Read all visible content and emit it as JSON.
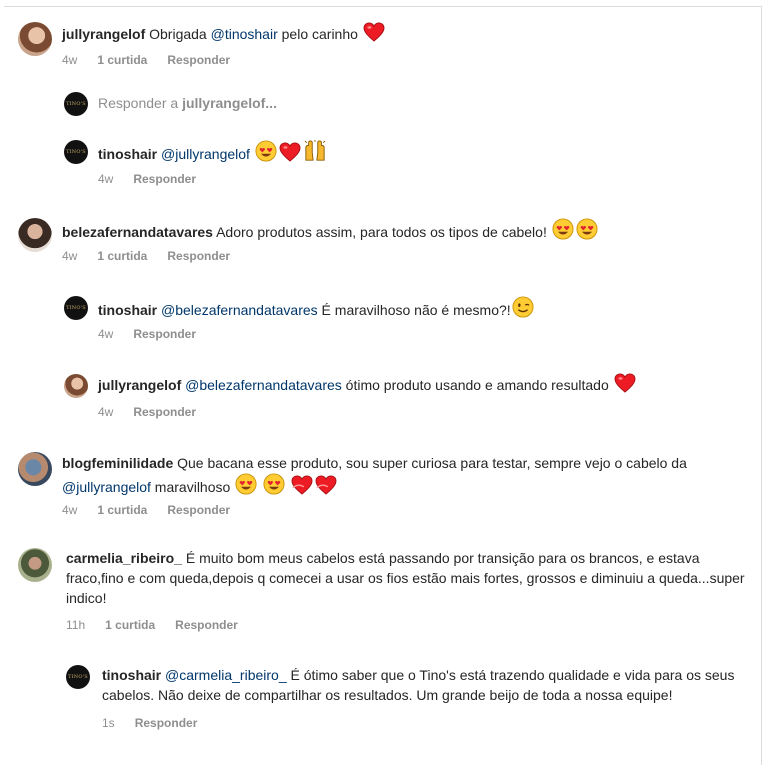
{
  "comments": [
    {
      "user": "jullyrangelof",
      "pre": "Obrigada ",
      "mention": "@tinoshair",
      "post": " pelo carinho",
      "emojis": [
        "heart"
      ],
      "time": "4w",
      "likes": "1 curtida",
      "reply": "Responder"
    },
    {
      "user": "tinoshair",
      "mention": "@jullyrangelof",
      "emojis": [
        "heart-eyes",
        "heart",
        "raised-hands"
      ],
      "time": "4w",
      "reply": "Responder"
    },
    {
      "user": "belezafernandatavares",
      "text": "Adoro produtos assim, para todos os tipos de cabelo!",
      "emojis": [
        "heart-eyes",
        "heart-eyes"
      ],
      "time": "4w",
      "likes": "1 curtida",
      "reply": "Responder"
    },
    {
      "user": "tinoshair",
      "mention": "@belezafernandatavares",
      "post": " É maravilhoso não é mesmo?!",
      "emojis": [
        "wink"
      ],
      "time": "4w",
      "reply": "Responder"
    },
    {
      "user": "jullyrangelof",
      "mention": "@belezafernandatavares",
      "post": " ótimo produto usando e amando resultado",
      "emojis": [
        "heart"
      ],
      "time": "4w",
      "reply": "Responder"
    },
    {
      "user": "blogfeminilidade",
      "pre": " Que bacana esse produto, sou super curiosa para testar, sempre vejo o cabelo da",
      "mention": "@jullyrangelof",
      "post": " maravilhoso",
      "emojis": [
        "heart-eyes",
        "heart-eyes",
        "heart-exclamation",
        "heart-exclamation"
      ],
      "time": "4w",
      "likes": "1 curtida",
      "reply": "Responder"
    },
    {
      "user": "carmelia_ribeiro_",
      "text": " É muito bom meus cabelos está passando por transição para os brancos, e estava fraco,fino e com queda,depois q comecei a usar os fios estão mais fortes, grossos e diminuiu a queda...super indico!",
      "time": "11h",
      "likes": "1 curtida",
      "reply": "Responder"
    },
    {
      "user": "tinoshair",
      "mention": "@carmelia_ribeiro_",
      "post": " É ótimo saber que o Tino's está trazendo qualidade e vida para os seus cabelos. Não deixe de compartilhar os resultados. Um grande beijo de toda a nossa equipe!",
      "time": "1s",
      "reply": "Responder"
    }
  ],
  "reply_input": {
    "prefix": "Responder a ",
    "target": "jullyrangelof...",
    "avatar_user": "tinoshair"
  },
  "colors": {
    "text": "#262626",
    "mention": "#00376b",
    "meta": "#8e8e8e",
    "heart": "#ed1c24"
  }
}
